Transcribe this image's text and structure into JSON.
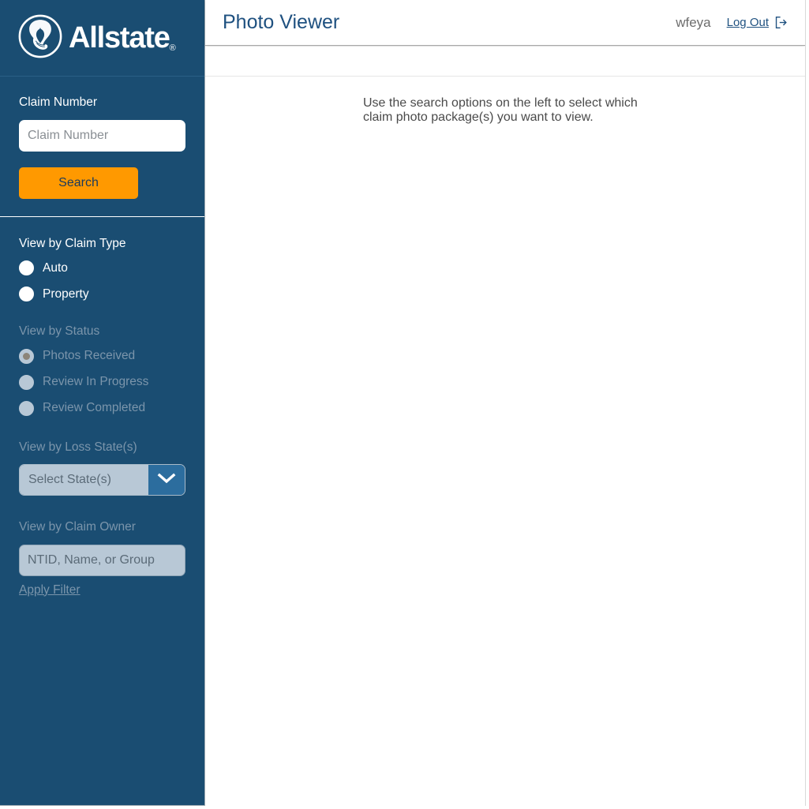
{
  "brand": {
    "name": "Allstate",
    "registered_mark": "®",
    "logo_icon": "allstate-good-hands-icon",
    "background_color": "#1a4d72"
  },
  "header": {
    "title": "Photo Viewer",
    "username": "wfeya",
    "logout_label": "Log Out",
    "logout_icon": "logout-arrow-icon",
    "title_color": "#1f5180"
  },
  "sidebar": {
    "claim_search": {
      "label": "Claim Number",
      "input_placeholder": "Claim Number",
      "input_value": "",
      "button_label": "Search",
      "button_color": "#ff9900"
    },
    "claim_type": {
      "label": "View by Claim Type",
      "enabled": true,
      "options": [
        {
          "label": "Auto",
          "selected": false
        },
        {
          "label": "Property",
          "selected": false
        }
      ]
    },
    "status": {
      "label": "View by Status",
      "enabled": false,
      "options": [
        {
          "label": "Photos Received",
          "selected": true
        },
        {
          "label": "Review In Progress",
          "selected": false
        },
        {
          "label": "Review Completed",
          "selected": false
        }
      ]
    },
    "loss_state": {
      "label": "View by Loss State(s)",
      "enabled": false,
      "selected_value": "Select State(s)",
      "chevron_icon": "chevron-down-icon"
    },
    "claim_owner": {
      "label": "View by Claim Owner",
      "input_placeholder": "NTID, Name, or Group",
      "input_value": "",
      "apply_filter_label": "Apply Filter"
    }
  },
  "main": {
    "message": "Use the search options on the left to select which claim photo package(s) you want to view."
  }
}
